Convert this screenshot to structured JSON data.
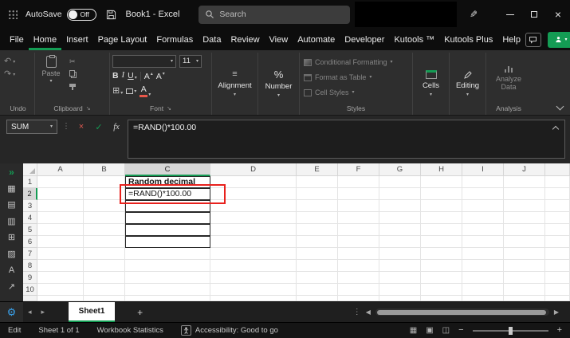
{
  "colors": {
    "accent_green": "#149c54",
    "annotation_red": "#e8211d",
    "gear_blue": "#3aa0e8"
  },
  "titlebar": {
    "autosave_label": "AutoSave",
    "autosave_state": "Off",
    "title": "Book1 - Excel",
    "search_placeholder": "Search"
  },
  "menubar": {
    "tabs": [
      "File",
      "Home",
      "Insert",
      "Page Layout",
      "Formulas",
      "Data",
      "Review",
      "View",
      "Automate",
      "Developer",
      "Kutools ™",
      "Kutools Plus",
      "Help"
    ],
    "active_tab": "Home"
  },
  "ribbon": {
    "group_labels": [
      "Undo",
      "Clipboard",
      "Font",
      "Styles",
      "Analysis"
    ],
    "paste_label": "Paste",
    "font_size": "11",
    "alignment_label": "Alignment",
    "number_label": "Number",
    "styles_buttons": [
      "Conditional Formatting",
      "Format as Table",
      "Cell Styles"
    ],
    "cells_label": "Cells",
    "editing_label": "Editing",
    "analyze_label": "Analyze Data"
  },
  "formula_bar": {
    "name_box": "SUM",
    "formula": "=RAND()*100.00"
  },
  "grid": {
    "columns": [
      "A",
      "B",
      "C",
      "D",
      "E",
      "F",
      "G",
      "H",
      "I",
      "J"
    ],
    "rows": [
      "1",
      "2",
      "3",
      "4",
      "5",
      "6",
      "7",
      "8",
      "9",
      "10"
    ],
    "cells": {
      "C1": "Random decimal",
      "C2": "=RAND()*100.00"
    },
    "bold_cells": [
      "C1"
    ],
    "active_col": "C",
    "active_row": "2",
    "bordered_col": "C",
    "bordered_rows": [
      1,
      6
    ]
  },
  "sheetbar": {
    "tabs": [
      "Sheet1"
    ],
    "active_tab": "Sheet1"
  },
  "statusbar": {
    "mode": "Edit",
    "sheet_info": "Sheet 1 of 1",
    "workbook_statistics": "Workbook Statistics",
    "accessibility": "Accessibility: Good to go"
  },
  "icons": {
    "dropdown": "▾",
    "undo": "↶",
    "redo": "↷",
    "cut": "✂",
    "bold": "B",
    "italic": "I",
    "underline": "U",
    "up_small": "▴",
    "down_small": "▾",
    "letter_a": "A",
    "borders": "⊞",
    "align_lines": "≡",
    "percent": "%",
    "cancel": "×",
    "check": "✓",
    "fx": "fx",
    "more_vertical": "⋮",
    "sheet_prev": "◂",
    "sheet_next": "▸",
    "scroll_left": "◀",
    "scroll_right": "▶",
    "add_sheet": "+",
    "close": "×",
    "view_normal": "▦",
    "view_layout": "▣",
    "view_break": "◫",
    "zoom_out": "−",
    "zoom_in": "+",
    "pen": "✎",
    "pane_expand": "»",
    "sidebar_calendar": "▦",
    "sidebar_clipboard": "▤",
    "sidebar_printer": "▥",
    "sidebar_table": "⊞",
    "sidebar_chart": "▨",
    "sidebar_text": "A",
    "sidebar_export": "↗",
    "gear": "⚙"
  }
}
